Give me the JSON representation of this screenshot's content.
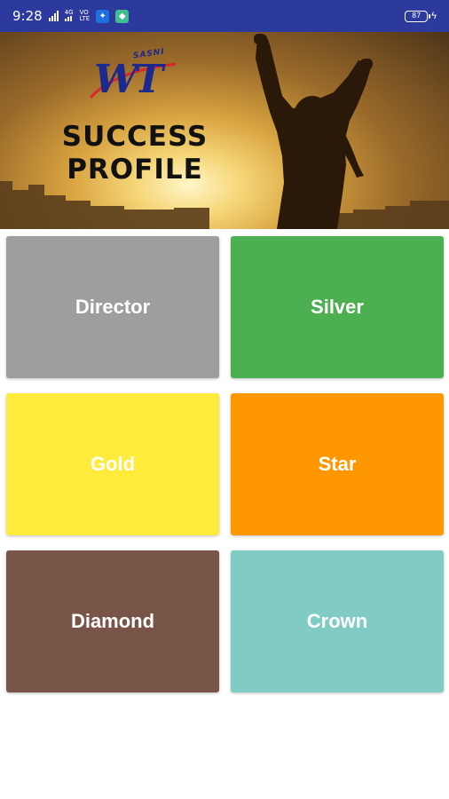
{
  "status_bar": {
    "time": "9:28",
    "net_top": "4G",
    "net_label_1": "VO",
    "net_label_2": "LTE",
    "battery": "87",
    "icons": [
      "signal-icon",
      "network-type-icon",
      "volte-icon",
      "app-notification-icon",
      "chat-notification-icon",
      "battery-icon",
      "charging-icon"
    ]
  },
  "banner": {
    "logo_brand": "SASNI",
    "logo_letters": "WT",
    "title_line_1": "SUCCESS",
    "title_line_2": "PROFILE"
  },
  "tiles": [
    {
      "label": "Director",
      "color": "#9e9e9e"
    },
    {
      "label": "Silver",
      "color": "#4caf50"
    },
    {
      "label": "Gold",
      "color": "#ffeb3b"
    },
    {
      "label": "Star",
      "color": "#ff9800"
    },
    {
      "label": "Diamond",
      "color": "#795548"
    },
    {
      "label": "Crown",
      "color": "#80cbc4"
    }
  ]
}
